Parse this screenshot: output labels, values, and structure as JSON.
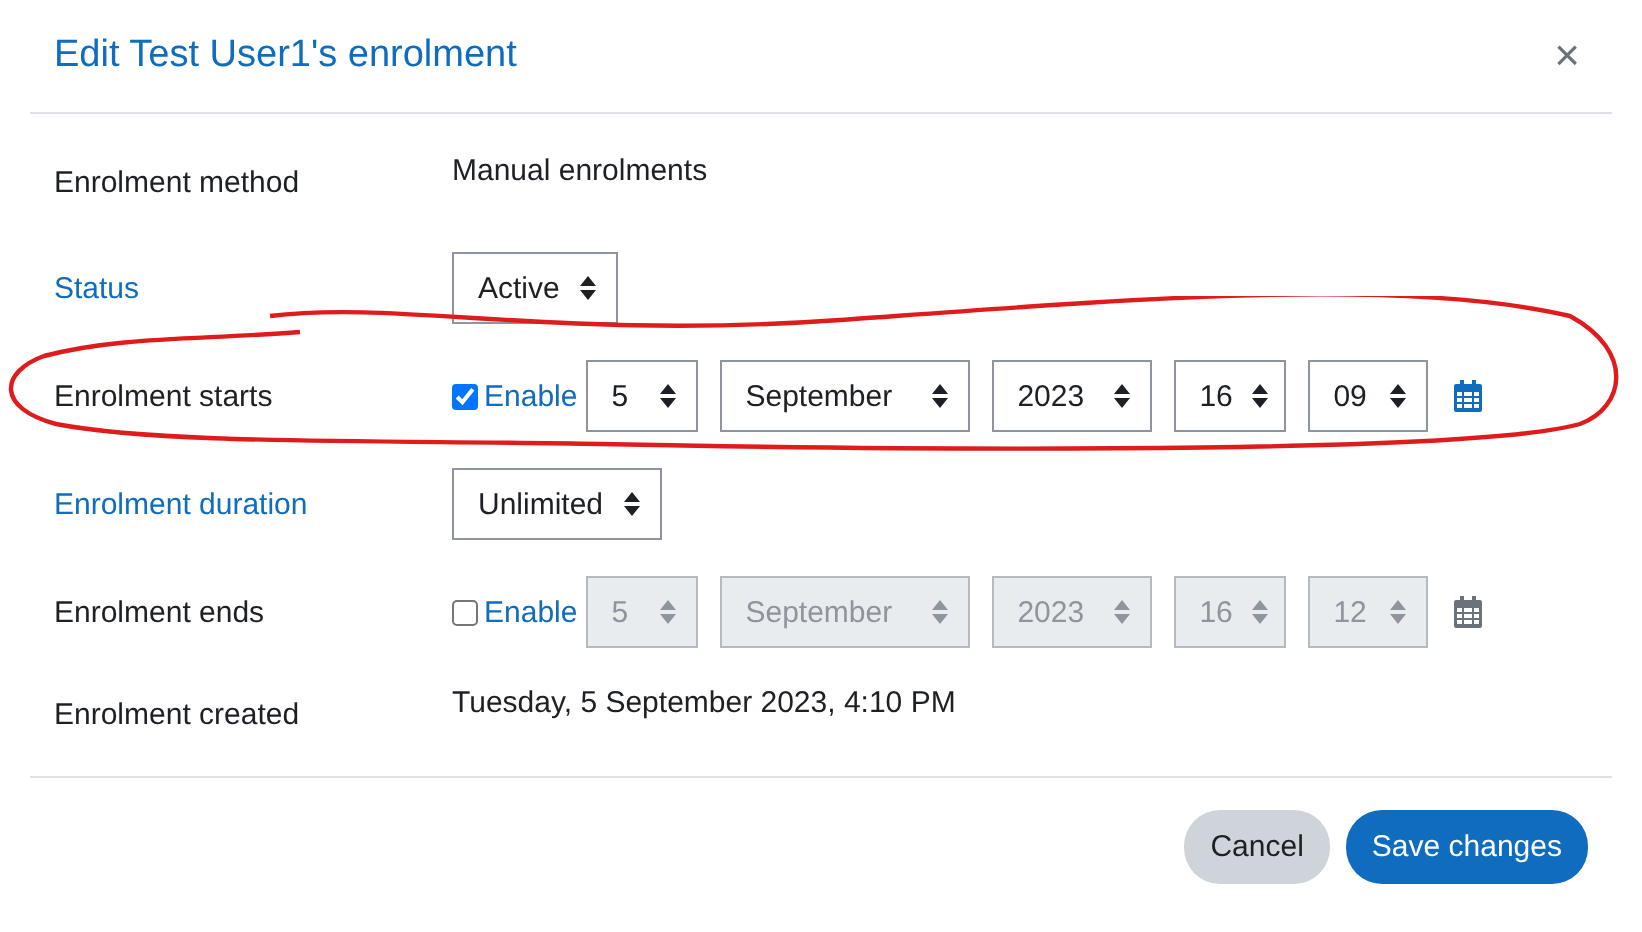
{
  "window": {
    "title": "Edit Test User1's enrolment",
    "close": "×"
  },
  "rows": [
    {
      "kind": "text",
      "label": "Enrolment method",
      "label_link": false,
      "value": "Manual enrolments"
    },
    {
      "kind": "select",
      "label": "Status",
      "label_link": true,
      "value": "Active"
    },
    {
      "kind": "datetime",
      "label": "Enrolment starts",
      "label_link": false,
      "enable_label": "Enable",
      "enabled": true,
      "fields": [
        "5",
        "September",
        "2023",
        "16",
        "09"
      ]
    },
    {
      "kind": "select",
      "label": "Enrolment duration",
      "label_link": true,
      "value": "Unlimited"
    },
    {
      "kind": "datetime",
      "label": "Enrolment ends",
      "label_link": false,
      "enable_label": "Enable",
      "enabled": false,
      "fields": [
        "5",
        "September",
        "2023",
        "16",
        "12"
      ]
    },
    {
      "kind": "text",
      "label": "Enrolment created",
      "label_link": false,
      "value": "Tuesday, 5 September 2023, 4:10 PM"
    }
  ],
  "buttons": [
    {
      "label": "Cancel",
      "kind": "secondary"
    },
    {
      "label": "Save changes",
      "kind": "primary"
    }
  ]
}
